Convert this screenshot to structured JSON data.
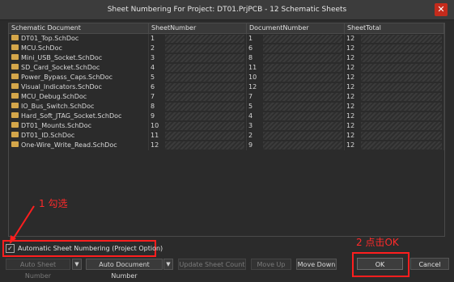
{
  "window": {
    "title": "Sheet Numbering For Project: DT01.PrjPCB  - 12 Schematic Sheets",
    "close_glyph": "✕"
  },
  "grid": {
    "columns": [
      "Schematic Document",
      "SheetNumber",
      "DocumentNumber",
      "SheetTotal"
    ],
    "rows": [
      {
        "doc": "DT01_Top.SchDoc",
        "sheet": "1",
        "docnum": "1",
        "total": "12"
      },
      {
        "doc": "MCU.SchDoc",
        "sheet": "2",
        "docnum": "6",
        "total": "12"
      },
      {
        "doc": "Mini_USB_Socket.SchDoc",
        "sheet": "3",
        "docnum": "8",
        "total": "12"
      },
      {
        "doc": "SD_Card_Socket.SchDoc",
        "sheet": "4",
        "docnum": "11",
        "total": "12"
      },
      {
        "doc": "Power_Bypass_Caps.SchDoc",
        "sheet": "5",
        "docnum": "10",
        "total": "12"
      },
      {
        "doc": "Visual_Indicators.SchDoc",
        "sheet": "6",
        "docnum": "12",
        "total": "12"
      },
      {
        "doc": "MCU_Debug.SchDoc",
        "sheet": "7",
        "docnum": "7",
        "total": "12"
      },
      {
        "doc": "IO_Bus_Switch.SchDoc",
        "sheet": "8",
        "docnum": "5",
        "total": "12"
      },
      {
        "doc": "Hard_Soft_JTAG_Socket.SchDoc",
        "sheet": "9",
        "docnum": "4",
        "total": "12"
      },
      {
        "doc": "DT01_Mounts.SchDoc",
        "sheet": "10",
        "docnum": "3",
        "total": "12"
      },
      {
        "doc": "DT01_ID.SchDoc",
        "sheet": "11",
        "docnum": "2",
        "total": "12"
      },
      {
        "doc": "One-Wire_Write_Read.SchDoc",
        "sheet": "12",
        "docnum": "9",
        "total": "12"
      }
    ]
  },
  "annotations": {
    "step1": "1 勾选",
    "step2": "2 点击OK"
  },
  "options": {
    "auto_numbering_label": "Automatic Sheet Numbering (Project Option)",
    "auto_numbering_checked": true,
    "check_glyph": "✓"
  },
  "buttons": {
    "auto_sheet_number": "Auto Sheet Number",
    "auto_document_number": "Auto Document Number",
    "update_sheet_count": "Update Sheet Count",
    "move_up": "Move Up",
    "move_down": "Move Down",
    "ok": "OK",
    "cancel": "Cancel",
    "dropdown_glyph": "▼"
  },
  "colors": {
    "annotation_red": "#ff1e1e",
    "folder_icon": "#d4a64a"
  }
}
